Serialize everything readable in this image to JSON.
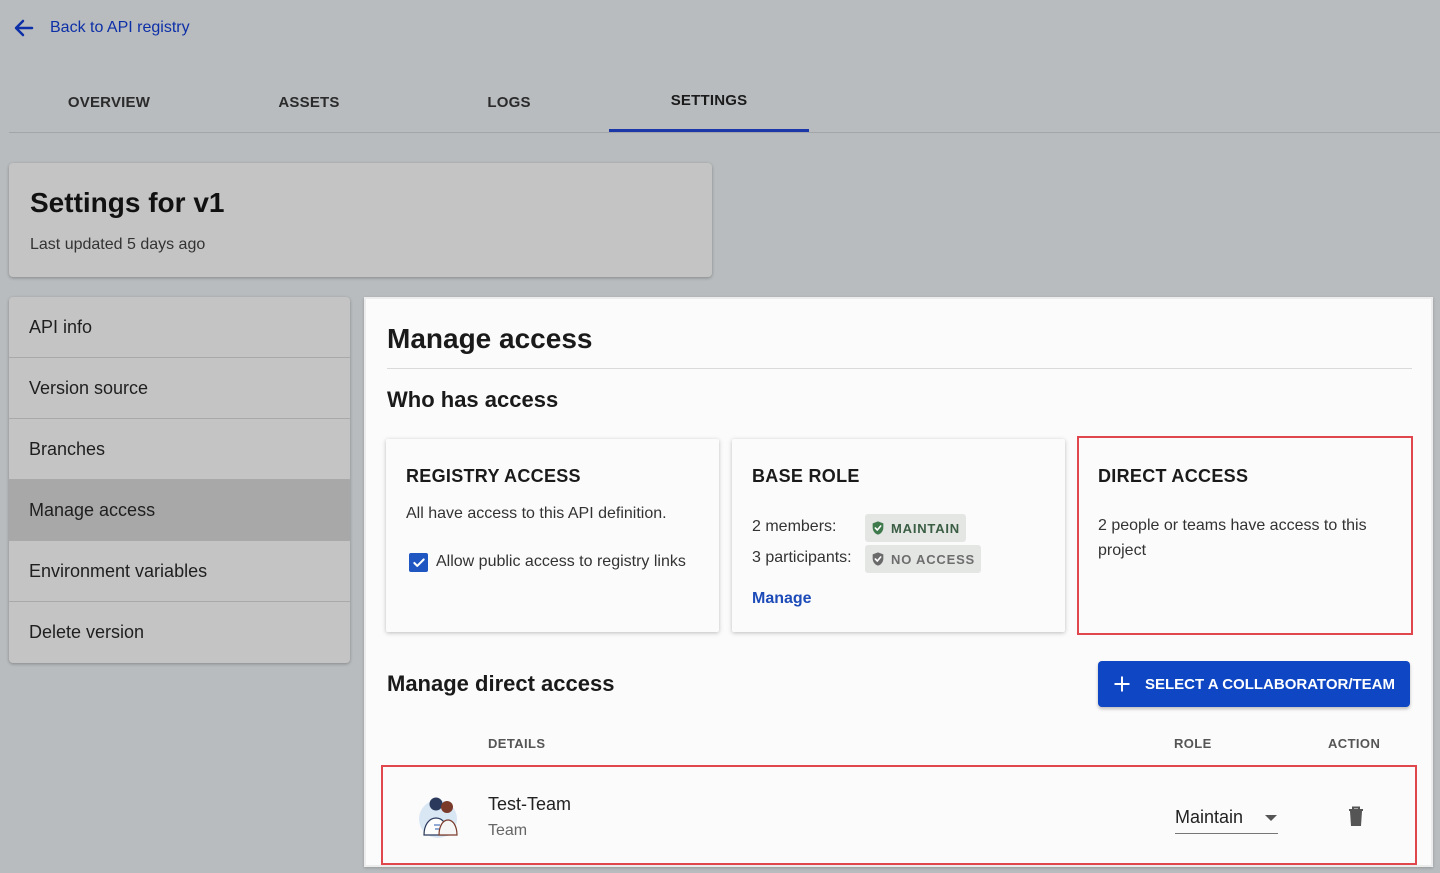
{
  "nav": {
    "back_label": "Back to API registry"
  },
  "tabs": [
    {
      "label": "OVERVIEW"
    },
    {
      "label": "ASSETS"
    },
    {
      "label": "LOGS"
    },
    {
      "label": "SETTINGS",
      "active": true
    }
  ],
  "header": {
    "title": "Settings for v1",
    "subtitle": "Last updated 5 days ago"
  },
  "sidebar": {
    "items": [
      {
        "label": "API info"
      },
      {
        "label": "Version source"
      },
      {
        "label": "Branches"
      },
      {
        "label": "Manage access",
        "active": true
      },
      {
        "label": "Environment variables"
      },
      {
        "label": "Delete version"
      }
    ]
  },
  "main": {
    "title": "Manage access",
    "who_has_access": "Who has access",
    "registry_card": {
      "title": "REGISTRY ACCESS",
      "description": "All have access to this API definition.",
      "checkbox_label": "Allow public access to registry links",
      "checkbox_checked": true
    },
    "base_role_card": {
      "title": "BASE ROLE",
      "members_label": "2 members:",
      "members_role": "MAINTAIN",
      "participants_label": "3 participants:",
      "participants_role": "NO ACCESS",
      "manage_link": "Manage"
    },
    "direct_access_card": {
      "title": "DIRECT ACCESS",
      "description_line1": "2 people or teams have access to this",
      "description_line2": "project"
    },
    "manage_direct_access": "Manage direct access",
    "select_button": "SELECT A COLLABORATOR/TEAM",
    "table": {
      "headers": {
        "details": "DETAILS",
        "role": "ROLE",
        "action": "ACTION"
      },
      "rows": [
        {
          "name": "Test-Team",
          "type": "Team",
          "role": "Maintain"
        }
      ]
    }
  },
  "colors": {
    "accent": "#0e46c4",
    "tab_indicator": "#1c37a8",
    "highlight_box": "#e0474d",
    "maintain_shield": "#3f7a4c",
    "no_access_shield": "#6a6a6a"
  },
  "icons": {
    "back": "arrow-left-icon",
    "checkbox": "check-icon",
    "maintain": "shield-check-icon",
    "no_access": "shield-check-icon",
    "add": "plus-icon",
    "avatar": "team-avatar",
    "dropdown": "caret-down-icon",
    "delete": "trash-icon"
  }
}
